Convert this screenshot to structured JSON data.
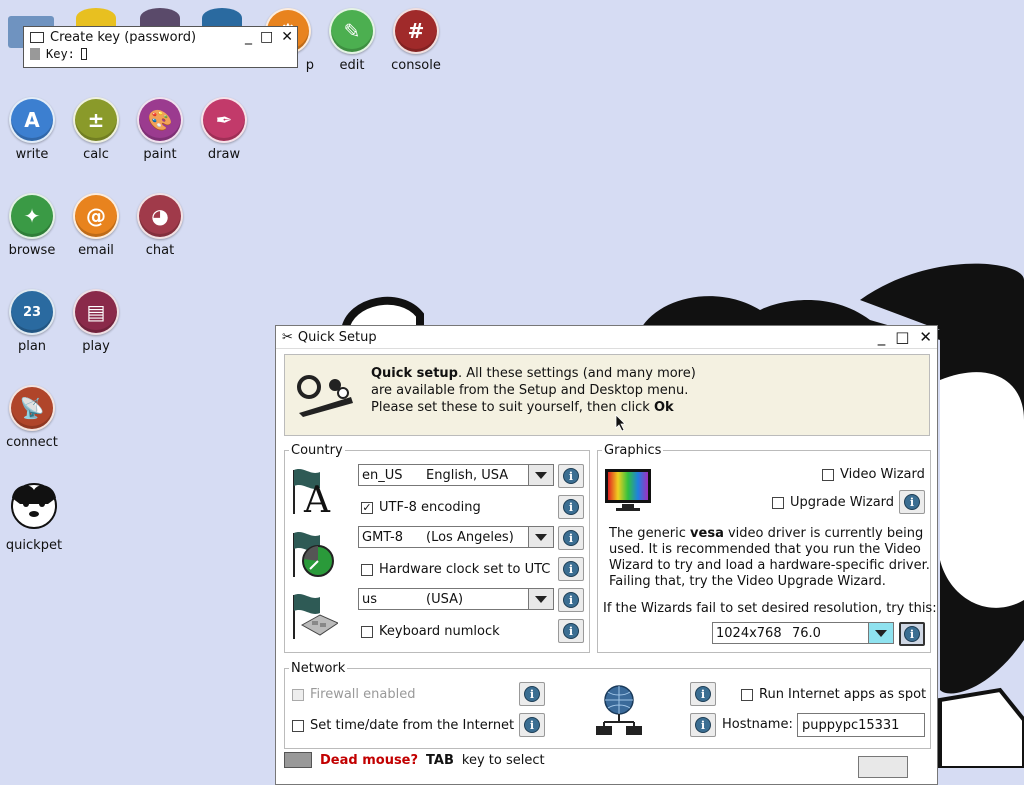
{
  "desktop_icons": [
    {
      "label": "edit",
      "icon": "edit-icon",
      "color": "#4caf50"
    },
    {
      "label": "console",
      "icon": "console-icon",
      "color": "#a02a2a"
    },
    {
      "label": "write",
      "icon": "write-icon",
      "color": "#3c7fd0"
    },
    {
      "label": "calc",
      "icon": "calc-icon",
      "color": "#8a9a2a"
    },
    {
      "label": "paint",
      "icon": "paint-icon",
      "color": "#9b3b8f"
    },
    {
      "label": "draw",
      "icon": "draw-icon",
      "color": "#c23a6a"
    },
    {
      "label": "browse",
      "icon": "browse-icon",
      "color": "#3a9a45"
    },
    {
      "label": "email",
      "icon": "email-icon",
      "color": "#e8831e"
    },
    {
      "label": "chat",
      "icon": "chat-icon",
      "color": "#a03a4a"
    },
    {
      "label": "plan",
      "icon": "plan-icon",
      "color": "#2a6aa0"
    },
    {
      "label": "play",
      "icon": "play-icon",
      "color": "#8a2a4a"
    },
    {
      "label": "connect",
      "icon": "connect-icon",
      "color": "#b0452a"
    },
    {
      "label": "quickpet",
      "icon": "quickpet-icon",
      "color": "#ffffff"
    },
    {
      "label": "p",
      "icon": "settings-icon",
      "color": "#e8831e"
    }
  ],
  "key_window": {
    "title": "Create key (password)",
    "key_label": "Key:"
  },
  "quick_setup": {
    "title": "Quick Setup",
    "banner": {
      "bold": "Quick setup",
      "line1_rest": ". All these settings (and many more)",
      "line2": "are available from the Setup and Desktop menu.",
      "line3_pre": "Please set these to suit yourself, then click ",
      "line3_bold": "Ok"
    },
    "country": {
      "legend": "Country",
      "locale_code": "en_US",
      "locale_name": "English, USA",
      "utf8_label": "UTF-8 encoding",
      "utf8_checked": true,
      "timezone_code": "GMT-8",
      "timezone_name": "(Los Angeles)",
      "hwclock_label": "Hardware clock set to UTC",
      "keyboard_code": "us",
      "keyboard_name": "(USA)",
      "numlock_label": "Keyboard numlock"
    },
    "graphics": {
      "legend": "Graphics",
      "video_wizard": "Video Wizard",
      "upgrade_wizard": "Upgrade Wizard",
      "desc_pre": "The generic ",
      "desc_bold": "vesa",
      "desc_line1_rest": " video driver is currently being",
      "desc_line2": "used. It is recommended that you run the Video",
      "desc_line3": "Wizard to try and load a hardware-specific driver.",
      "desc_line4": "Failing that, try the Video Upgrade Wizard.",
      "fallback_text": "If the Wizards fail to set desired resolution, try this:",
      "resolution": "1024x768",
      "refresh": "76.0"
    },
    "network": {
      "legend": "Network",
      "firewall_label": "Firewall enabled",
      "timedate_label": "Set time/date from the Internet",
      "spot_label": "Run Internet apps as spot",
      "hostname_label": "Hostname:",
      "hostname_value": "puppypc15331"
    },
    "footer": {
      "red": "Dead mouse?",
      "bold": "TAB",
      "rest": "key to select"
    }
  }
}
